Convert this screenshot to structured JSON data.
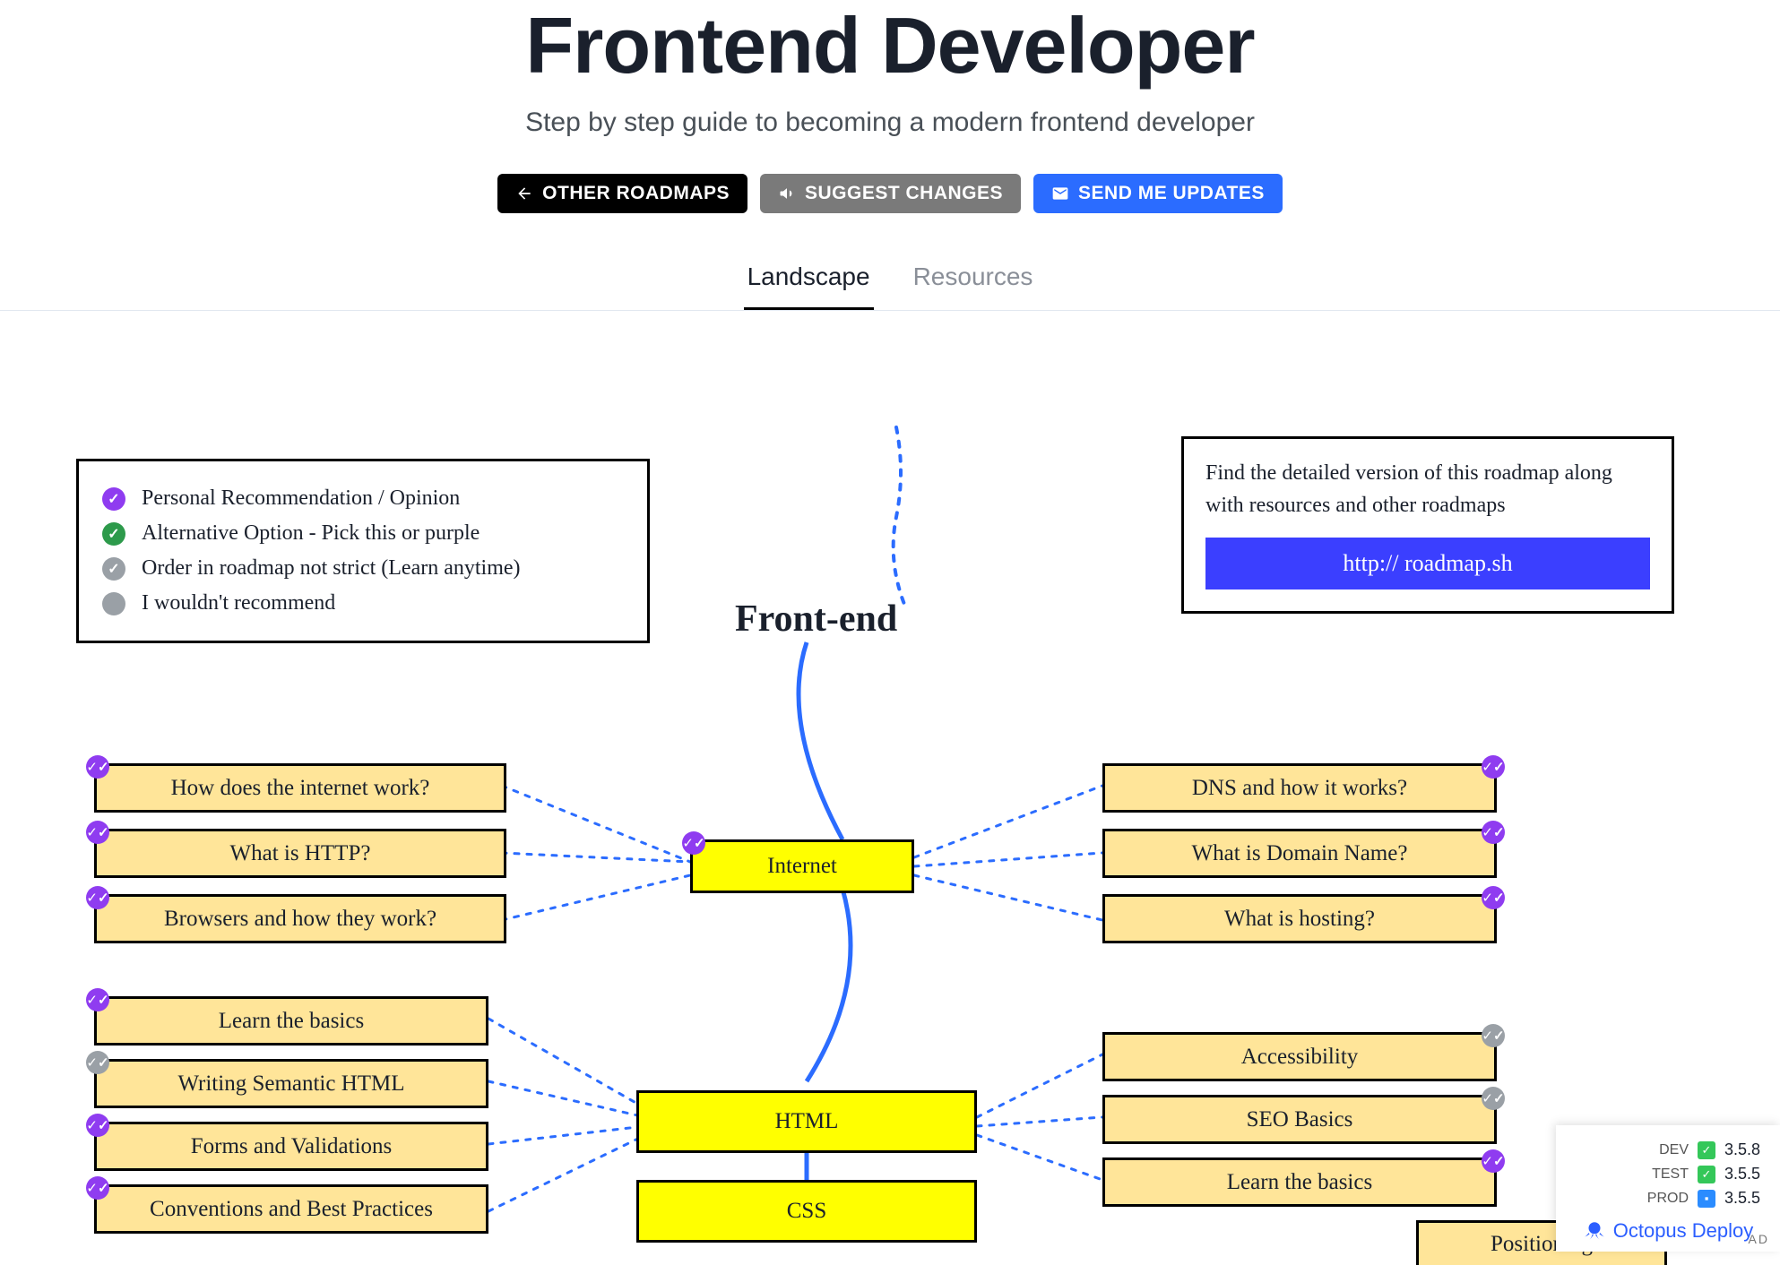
{
  "header": {
    "title": "Frontend Developer",
    "subtitle": "Step by step guide to becoming a modern frontend developer"
  },
  "buttons": {
    "other": "OTHER ROADMAPS",
    "suggest": "SUGGEST CHANGES",
    "updates": "SEND ME UPDATES"
  },
  "tabs": {
    "landscape": "Landscape",
    "resources": "Resources"
  },
  "legend": {
    "items": [
      "Personal Recommendation / Opinion",
      "Alternative Option - Pick this or purple",
      "Order in roadmap not strict (Learn anytime)",
      "I wouldn't recommend"
    ]
  },
  "infobox": {
    "text": "Find the detailed version of this roadmap along with resources and other roadmaps",
    "link": "http:// roadmap.sh"
  },
  "fe_title": "Front-end",
  "nodes": {
    "internet": "Internet",
    "html": "HTML",
    "css": "CSS",
    "left_internet": [
      "How does the internet work?",
      "What is HTTP?",
      "Browsers and how they work?"
    ],
    "right_internet": [
      "DNS and how it works?",
      "What is Domain Name?",
      "What is hosting?"
    ],
    "left_html": [
      "Learn the basics",
      "Writing Semantic HTML",
      "Forms and Validations",
      "Conventions and Best Practices"
    ],
    "right_html": [
      "Accessibility",
      "SEO Basics",
      "Learn the basics"
    ],
    "positioning": "Positioning"
  },
  "widget": {
    "rows": [
      {
        "env": "DEV",
        "status": "ok",
        "ver": "3.5.8"
      },
      {
        "env": "TEST",
        "status": "ok",
        "ver": "3.5.5"
      },
      {
        "env": "PROD",
        "status": "box",
        "ver": "3.5.5"
      }
    ],
    "brand": "Octopus Deploy",
    "ad": "AD"
  }
}
